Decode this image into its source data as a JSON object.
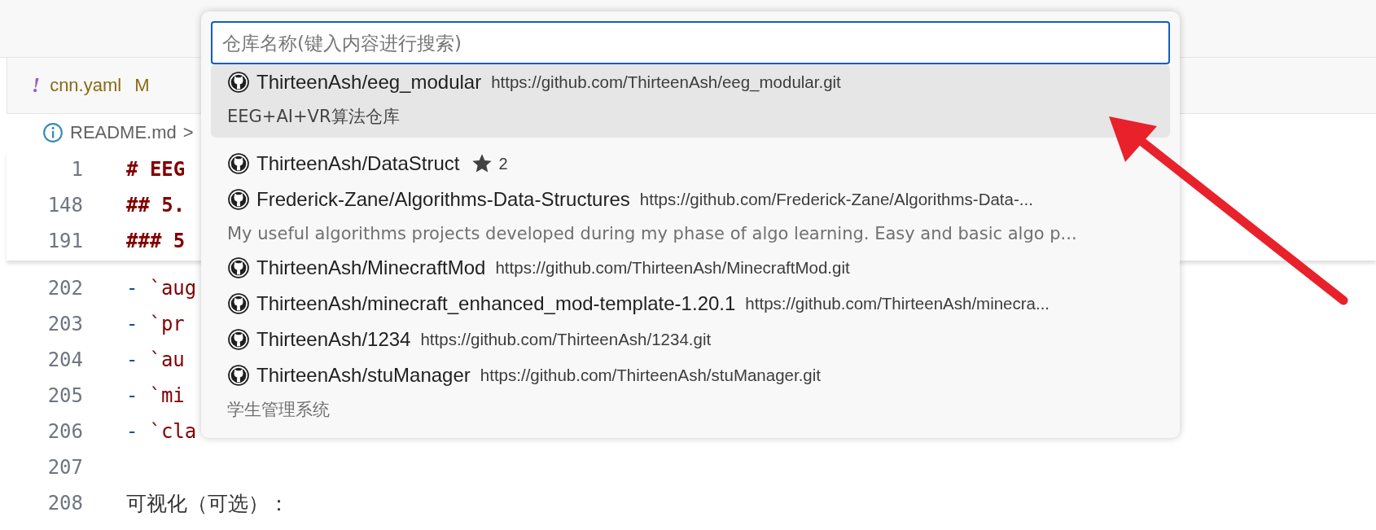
{
  "tabs": [
    {
      "icon": "!",
      "label": "cnn.yaml",
      "badge": "M"
    }
  ],
  "breadcrumb": {
    "file": "README.md",
    "separator": ">"
  },
  "sticky_lines": [
    {
      "number": "1",
      "text": "# EEG"
    },
    {
      "number": "148",
      "text": "## 5."
    },
    {
      "number": "191",
      "text": "### 5"
    }
  ],
  "lines": [
    {
      "number": "202",
      "kind": "list",
      "text": "`aug"
    },
    {
      "number": "203",
      "kind": "list",
      "text": "`pr"
    },
    {
      "number": "204",
      "kind": "list",
      "text": "`au"
    },
    {
      "number": "205",
      "kind": "list",
      "text": "`mi"
    },
    {
      "number": "206",
      "kind": "list",
      "text": "`cla"
    },
    {
      "number": "207",
      "kind": "blank"
    },
    {
      "number": "208",
      "kind": "plain",
      "text": "可视化（可选）："
    }
  ],
  "list_marker": "-",
  "quick_pick": {
    "placeholder": "仓库名称(键入内容进行搜索)",
    "items": [
      {
        "name": "ThirteenAsh/eeg_modular",
        "url": "https://github.com/ThirteenAsh/eeg_modular.git",
        "description": "EEG+AI+VR算法仓库",
        "selected": true
      },
      {
        "name": "ThirteenAsh/DataStruct",
        "star_count": "2",
        "selected": false
      },
      {
        "name": "Frederick-Zane/Algorithms-Data-Structures",
        "url": "https://github.com/Frederick-Zane/Algorithms-Data-...",
        "description": "My useful algorithms projects developed during my phase of algo learning. Easy and basic algo p...",
        "selected": false
      },
      {
        "name": "ThirteenAsh/MinecraftMod",
        "url": "https://github.com/ThirteenAsh/MinecraftMod.git",
        "selected": false
      },
      {
        "name": "ThirteenAsh/minecraft_enhanced_mod-template-1.20.1",
        "url": "https://github.com/ThirteenAsh/minecra...",
        "selected": false
      },
      {
        "name": "ThirteenAsh/1234",
        "url": "https://github.com/ThirteenAsh/1234.git",
        "selected": false
      },
      {
        "name": "ThirteenAsh/stuManager",
        "url": "https://github.com/ThirteenAsh/stuManager.git",
        "description": "学生管理系统",
        "selected": false
      }
    ]
  }
}
